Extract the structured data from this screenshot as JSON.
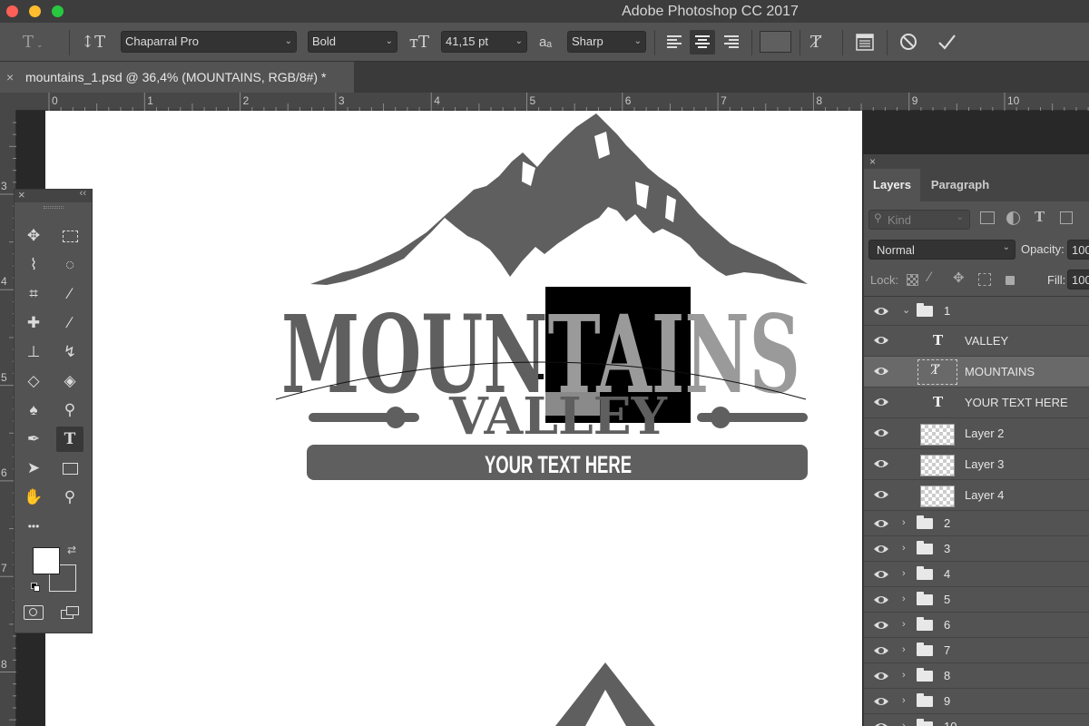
{
  "window": {
    "title": "Adobe Photoshop CC 2017",
    "colors": {
      "close": "#fe5f57",
      "minimize": "#febc2e",
      "zoom": "#28c840"
    }
  },
  "options_bar": {
    "font_family": "Chaparral Pro",
    "font_style": "Bold",
    "font_size": "41,15 pt",
    "antialias_glyph": "aₐ",
    "antialias": "Sharp",
    "icons": [
      "type-tool-icon",
      "text-orientation-icon",
      "font-size-icon",
      "antialias-icon",
      "align-left-icon",
      "align-center-icon",
      "align-right-icon",
      "color-swatch",
      "warp-text-icon",
      "character-panel-icon",
      "cancel-icon",
      "commit-icon"
    ]
  },
  "document": {
    "tab_label": "mountains_1.psd @ 36,4% (MOUNTAINS, RGB/8#) *",
    "close": "×"
  },
  "rulers": {
    "top_ticks": [
      "0",
      "1",
      "2",
      "3",
      "4",
      "5",
      "6",
      "7",
      "8",
      "9",
      "10"
    ],
    "left_ticks": [
      "3",
      "4",
      "5",
      "6",
      "7",
      "8"
    ]
  },
  "canvas": {
    "mountains_text": "MOUNTAINS",
    "valley_text": "VALLEY",
    "banner_text": "YOUR TEXT HERE",
    "logo_color": "#5f5f5f",
    "selected_text_color": "#9a9a9a"
  },
  "layers_panel": {
    "tabs": [
      "Layers",
      "Paragraph"
    ],
    "filter_placeholder": "Kind",
    "blend_mode": "Normal",
    "opacity_label": "Opacity:",
    "opacity_value": "100",
    "lock_label": "Lock:",
    "fill_label": "Fill:",
    "fill_value": "100",
    "group_open": {
      "name": "1"
    },
    "layers": [
      {
        "name": "VALLEY",
        "kind": "text"
      },
      {
        "name": "MOUNTAINS",
        "kind": "warped-text",
        "selected": true
      },
      {
        "name": "YOUR TEXT HERE",
        "kind": "text"
      },
      {
        "name": "Layer 2",
        "kind": "pixel"
      },
      {
        "name": "Layer 3",
        "kind": "pixel"
      },
      {
        "name": "Layer 4",
        "kind": "pixel"
      }
    ],
    "groups": [
      {
        "name": "2"
      },
      {
        "name": "3"
      },
      {
        "name": "4"
      },
      {
        "name": "5"
      },
      {
        "name": "6"
      },
      {
        "name": "7"
      },
      {
        "name": "8"
      },
      {
        "name": "9"
      },
      {
        "name": "10"
      }
    ]
  },
  "tools": [
    "move-tool",
    "marquee-tool",
    "lasso-tool",
    "quick-selection-tool",
    "crop-tool",
    "eyedropper-tool",
    "healing-brush-tool",
    "brush-tool",
    "clone-stamp-tool",
    "history-brush-tool",
    "eraser-tool",
    "paint-bucket-tool",
    "blur-tool",
    "dodge-tool",
    "pen-tool",
    "type-tool",
    "path-selection-tool",
    "rectangle-tool",
    "hand-tool",
    "zoom-tool"
  ],
  "tools_more": "•••",
  "swatches": {
    "foreground": "#ffffff",
    "background": "#535353"
  }
}
